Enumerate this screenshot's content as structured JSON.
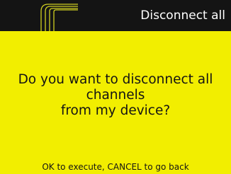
{
  "header": {
    "title": "Disconnect all"
  },
  "dialog": {
    "message_lines": [
      "Do you want to disconnect all",
      "channels",
      "from my device?"
    ],
    "hint": "OK to execute, CANCEL to go back"
  },
  "colors": {
    "header_background": "#141414",
    "body_background": "#f2ee00",
    "text_light": "#ffffff",
    "text_dark": "#141414",
    "decoration_stroke": "#cfcf20"
  }
}
